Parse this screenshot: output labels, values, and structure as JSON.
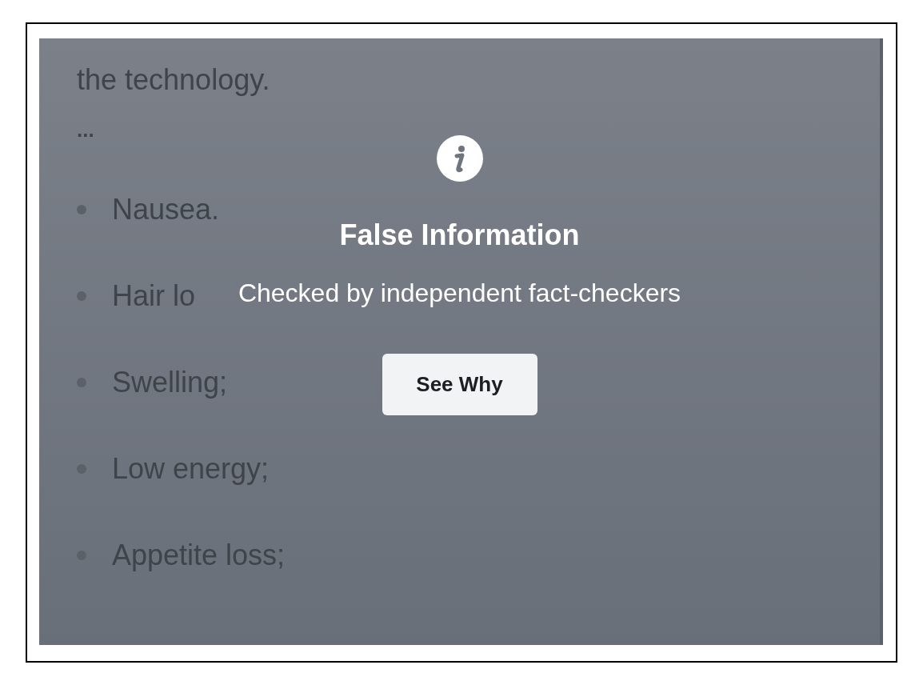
{
  "article": {
    "lines": [
      "the technology.",
      "..."
    ],
    "bullets": [
      "Nausea.",
      "Hair lo",
      "Swelling;",
      "Low energy;",
      "Appetite loss;"
    ]
  },
  "overlay": {
    "title": "False Information",
    "subtitle": "Checked by independent fact-checkers",
    "button": "See Why"
  }
}
